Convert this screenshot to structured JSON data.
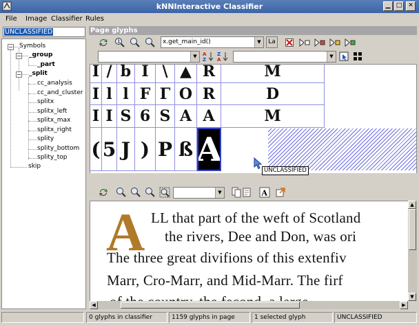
{
  "window": {
    "title": "kNNInteractive Classifier"
  },
  "menubar": [
    {
      "label": "File"
    },
    {
      "label": "Image"
    },
    {
      "label": "Classifier"
    },
    {
      "label": "Rules"
    }
  ],
  "left_panel": {
    "selected_class": "UNCLASSIFIED",
    "tree": {
      "symbols": "Symbols",
      "group": "_group",
      "part": "_part",
      "split": "_split",
      "split_children": [
        "cc_analysis",
        "cc_and_cluster",
        "splitx",
        "splitx_left",
        "splitx_max",
        "splitx_right",
        "splity",
        "splity_bottom",
        "splity_top"
      ],
      "skip": "skip"
    }
  },
  "glyph_panel": {
    "header": "Page glyphs",
    "id_combo_value": "x.get_main_id()",
    "label_button": "La",
    "rows": [
      [
        "I",
        "/",
        "b",
        "I",
        "\\",
        "▲",
        "R",
        "M"
      ],
      [
        "I",
        "l",
        "l",
        "F",
        "Γ",
        "O",
        "R",
        "D"
      ],
      [
        "I",
        "I",
        "S",
        "6",
        "S",
        "A",
        "A",
        "M"
      ],
      [
        "(",
        "5",
        "J",
        ")",
        "P",
        "ß",
        "A",
        ""
      ]
    ],
    "selected_glyph": "A",
    "tooltip": "UNCLASSIFIED"
  },
  "page_panel": {
    "dropcap": "A",
    "lines": [
      "LL that part of the weft of Scotland",
      "the rivers, Dee and Don, was ori",
      "The three great divifions of this extenfiv",
      "Marr, Cro-Marr, and Mid-Marr.  The firf",
      "of the country, the fecond, a large"
    ]
  },
  "statusbar": {
    "classifier_count": "0 glyphs in classifier",
    "page_count": "1159 glyphs in page",
    "selected_count": "1 selected glyph",
    "selected_class": "UNCLASSIFIED"
  },
  "colors": {
    "accent": "#3c64a6",
    "grid_line": "#8f8fe0",
    "dropcap": "#b07a28"
  },
  "icons": [
    "app-icon",
    "minimize-icon",
    "maximize-icon",
    "close-icon",
    "refresh-icon",
    "zoom-normal-icon",
    "zoom-in-icon",
    "zoom-out-icon",
    "zoom-fit-icon",
    "delete-icon",
    "play-icon",
    "sort-ascending-icon",
    "sort-descending-icon"
  ]
}
